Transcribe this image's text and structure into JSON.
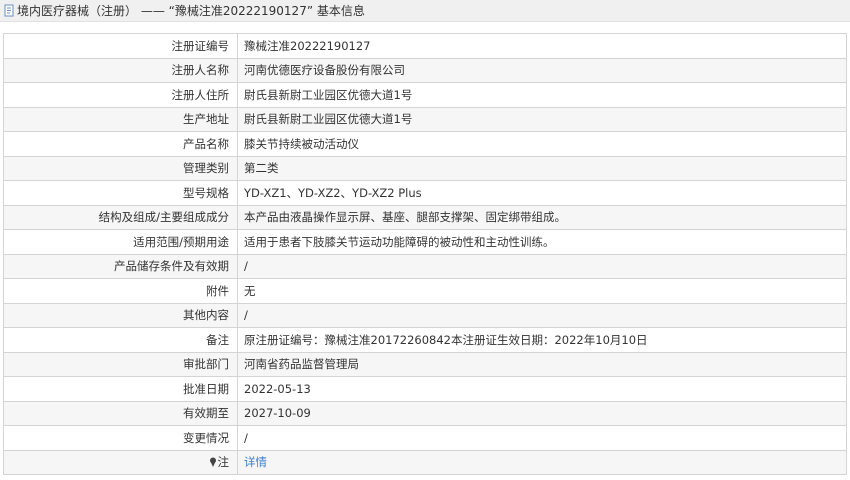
{
  "header": {
    "title": "境内医疗器械（注册） —— “豫械注准20222190127” 基本信息"
  },
  "rows": [
    {
      "label": "注册证编号",
      "value": "豫械注准20222190127"
    },
    {
      "label": "注册人名称",
      "value": "河南优德医疗设备股份有限公司"
    },
    {
      "label": "注册人住所",
      "value": "尉氏县新尉工业园区优德大道1号"
    },
    {
      "label": "生产地址",
      "value": "尉氏县新尉工业园区优德大道1号"
    },
    {
      "label": "产品名称",
      "value": "膝关节持续被动活动仪"
    },
    {
      "label": "管理类别",
      "value": "第二类"
    },
    {
      "label": "型号规格",
      "value": "YD-XZ1、YD-XZ2、YD-XZ2 Plus"
    },
    {
      "label": "结构及组成/主要组成成分",
      "value": "本产品由液晶操作显示屏、基座、腿部支撑架、固定绑带组成。"
    },
    {
      "label": "适用范围/预期用途",
      "value": "适用于患者下肢膝关节运动功能障碍的被动性和主动性训练。"
    },
    {
      "label": "产品储存条件及有效期",
      "value": "/"
    },
    {
      "label": "附件",
      "value": "无"
    },
    {
      "label": "其他内容",
      "value": "/"
    },
    {
      "label": "备注",
      "value": "原注册证编号：豫械注准20172260842本注册证生效日期：2022年10月10日"
    },
    {
      "label": "审批部门",
      "value": "河南省药品监督管理局"
    },
    {
      "label": "批准日期",
      "value": "2022-05-13"
    },
    {
      "label": "有效期至",
      "value": "2027-10-09"
    },
    {
      "label": "变更情况",
      "value": "/"
    },
    {
      "label": "注",
      "value": "详情"
    }
  ],
  "icons": {
    "header": "document-icon",
    "note": "pin-icon"
  },
  "colors": {
    "link": "#3a7fd1",
    "header_bg": "#f0f0f0",
    "row_shade": "#f6f6f6",
    "border": "#d4d4d4"
  }
}
